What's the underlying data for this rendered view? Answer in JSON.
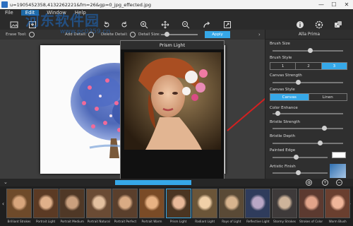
{
  "window": {
    "title": "u=1905452358,4132262221&fm=26&gp=0_jpg_effected.jpg",
    "controls": [
      "—",
      "☐",
      "✕"
    ]
  },
  "menu": {
    "items": [
      "File",
      "Edit",
      "Window",
      "Help"
    ]
  },
  "watermark": {
    "main": "河东软件园",
    "sub": "www.pc0359.cn"
  },
  "options": {
    "erase_tool": "Erase Tool:",
    "add_detail": "Add Detail:",
    "delete_detail": "Delete Detail:",
    "detail_size": "Detail Size:",
    "apply": "Apply"
  },
  "popup": {
    "title": "Prism Light"
  },
  "panel": {
    "title": "Alla Prima",
    "brush_size": "Brush Size",
    "brush_style": "Brush Style",
    "brush_style_options": [
      "1",
      "2",
      "3"
    ],
    "canvas_strength": "Canvas Strength",
    "canvas_style": "Canvas Style",
    "canvas_style_options": [
      "Canvas",
      "Linen"
    ],
    "color_enhance": "Color Enhance",
    "bristle_strength": "Bristle Strength",
    "bristle_depth": "Bristle Depth",
    "painted_edge": "Painted Edge",
    "artistic_finish": "Artistic Finish",
    "sliders": {
      "brush_size": 0.52,
      "canvas_strength": 0.35,
      "color_enhance": 0.06,
      "bristle_strength": 0.72,
      "bristle_depth": 0.66,
      "painted_edge": 0.4,
      "artistic_finish": 0.44
    },
    "accent": "#36a8e8"
  },
  "filmstrip": {
    "thumbs": [
      "Brilliant Strokes",
      "Portrait Light",
      "Portrait Medium",
      "Portrait Natural",
      "Portrait Perfect",
      "Portrait Warm",
      "Prism Light",
      "Radiant Light",
      "Rays of Light",
      "Reflective Light",
      "Stormy Strokes",
      "Strokes of Color",
      "Warm Blush"
    ],
    "selected": "Prism Light"
  }
}
